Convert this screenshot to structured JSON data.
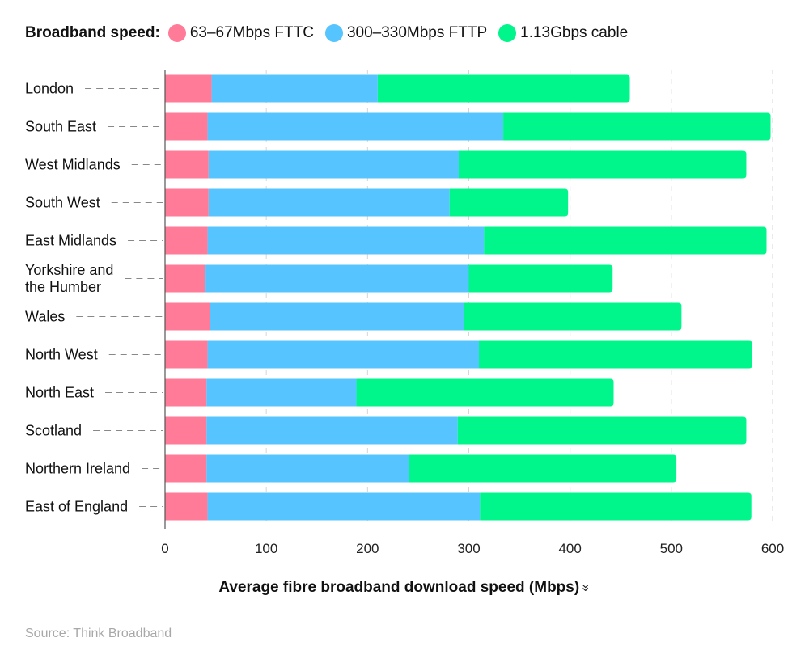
{
  "legend": {
    "title": "Broadband speed:",
    "items": [
      {
        "label": "63–67Mbps FTTC",
        "color": "#ff7b97"
      },
      {
        "label": "300–330Mbps FTTP",
        "color": "#55c4ff"
      },
      {
        "label": "1.13Gbps cable",
        "color": "#00f58a"
      }
    ]
  },
  "axis_title": "Average fibre broadband download speed (Mbps)",
  "axis_title_icon": "double-chevron-down-icon",
  "axis_title_icon_glyph": "»",
  "source": "Source: Think Broadband",
  "chart_data": {
    "type": "bar",
    "orientation": "horizontal",
    "stacked": true,
    "title": "",
    "xlabel": "Average fibre broadband download speed (Mbps)",
    "ylabel": "",
    "xlim": [
      0,
      600
    ],
    "xticks": [
      0,
      100,
      200,
      300,
      400,
      500,
      600
    ],
    "grid": true,
    "legend_position": "top-left",
    "categories": [
      [
        "London"
      ],
      [
        "South East"
      ],
      [
        "West Midlands"
      ],
      [
        "South West"
      ],
      [
        "East Midlands"
      ],
      [
        "Yorkshire and",
        "the Humber"
      ],
      [
        "Wales"
      ],
      [
        "North West"
      ],
      [
        "North East"
      ],
      [
        "Scotland"
      ],
      [
        "Northern Ireland"
      ],
      [
        "East of England"
      ]
    ],
    "series": [
      {
        "name": "63–67Mbps FTTC",
        "color": "#ff7b97",
        "values": [
          46,
          42,
          43,
          43,
          42,
          40,
          44,
          42,
          41,
          41,
          41,
          42
        ]
      },
      {
        "name": "300–330Mbps FTTP",
        "color": "#55c4ff",
        "values": [
          164,
          292,
          247,
          238,
          273,
          260,
          251,
          268,
          148,
          248,
          200,
          269
        ]
      },
      {
        "name": "1.13Gbps cable",
        "color": "#00f58a",
        "values": [
          249,
          264,
          284,
          117,
          279,
          142,
          215,
          270,
          254,
          285,
          264,
          268
        ]
      }
    ]
  }
}
